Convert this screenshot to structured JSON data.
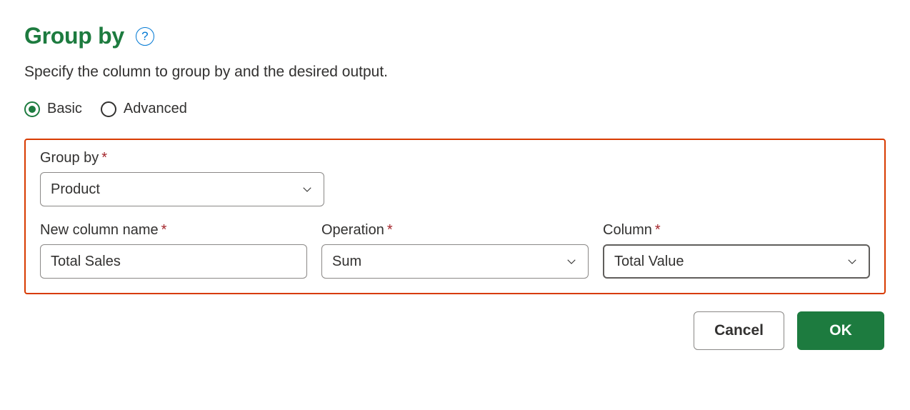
{
  "header": {
    "title": "Group by",
    "help_icon": "?",
    "subtitle": "Specify the column to group by and the desired output."
  },
  "mode": {
    "basic_label": "Basic",
    "advanced_label": "Advanced",
    "selected": "basic"
  },
  "form": {
    "group_by": {
      "label": "Group by",
      "value": "Product"
    },
    "new_column_name": {
      "label": "New column name",
      "value": "Total Sales"
    },
    "operation": {
      "label": "Operation",
      "value": "Sum"
    },
    "column": {
      "label": "Column",
      "value": "Total Value"
    }
  },
  "buttons": {
    "cancel": "Cancel",
    "ok": "OK"
  }
}
